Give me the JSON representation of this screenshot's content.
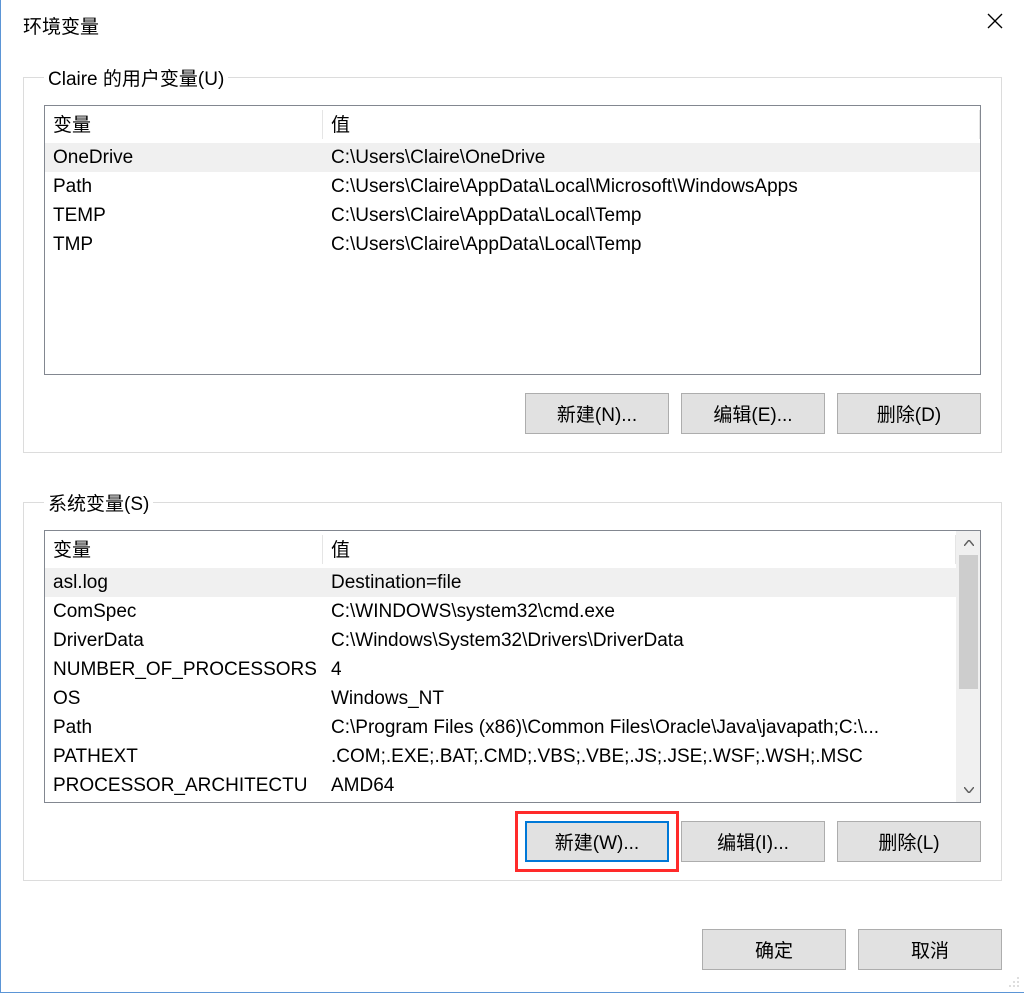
{
  "window": {
    "title": "环境变量"
  },
  "user_vars": {
    "legend": "Claire 的用户变量(U)",
    "headers": {
      "var": "变量",
      "val": "值"
    },
    "rows": [
      {
        "var": "OneDrive",
        "val": "C:\\Users\\Claire\\OneDrive"
      },
      {
        "var": "Path",
        "val": "C:\\Users\\Claire\\AppData\\Local\\Microsoft\\WindowsApps"
      },
      {
        "var": "TEMP",
        "val": "C:\\Users\\Claire\\AppData\\Local\\Temp"
      },
      {
        "var": "TMP",
        "val": "C:\\Users\\Claire\\AppData\\Local\\Temp"
      }
    ],
    "buttons": {
      "new": "新建(N)...",
      "edit": "编辑(E)...",
      "delete": "删除(D)"
    }
  },
  "system_vars": {
    "legend": "系统变量(S)",
    "headers": {
      "var": "变量",
      "val": "值"
    },
    "rows": [
      {
        "var": "asl.log",
        "val": "Destination=file"
      },
      {
        "var": "ComSpec",
        "val": "C:\\WINDOWS\\system32\\cmd.exe"
      },
      {
        "var": "DriverData",
        "val": "C:\\Windows\\System32\\Drivers\\DriverData"
      },
      {
        "var": "NUMBER_OF_PROCESSORS",
        "val": "4"
      },
      {
        "var": "OS",
        "val": "Windows_NT"
      },
      {
        "var": "Path",
        "val": "C:\\Program Files (x86)\\Common Files\\Oracle\\Java\\javapath;C:\\..."
      },
      {
        "var": "PATHEXT",
        "val": ".COM;.EXE;.BAT;.CMD;.VBS;.VBE;.JS;.JSE;.WSF;.WSH;.MSC"
      },
      {
        "var": "PROCESSOR_ARCHITECTU",
        "val": "AMD64"
      }
    ],
    "buttons": {
      "new": "新建(W)...",
      "edit": "编辑(I)...",
      "delete": "删除(L)"
    }
  },
  "dialog_buttons": {
    "ok": "确定",
    "cancel": "取消"
  }
}
